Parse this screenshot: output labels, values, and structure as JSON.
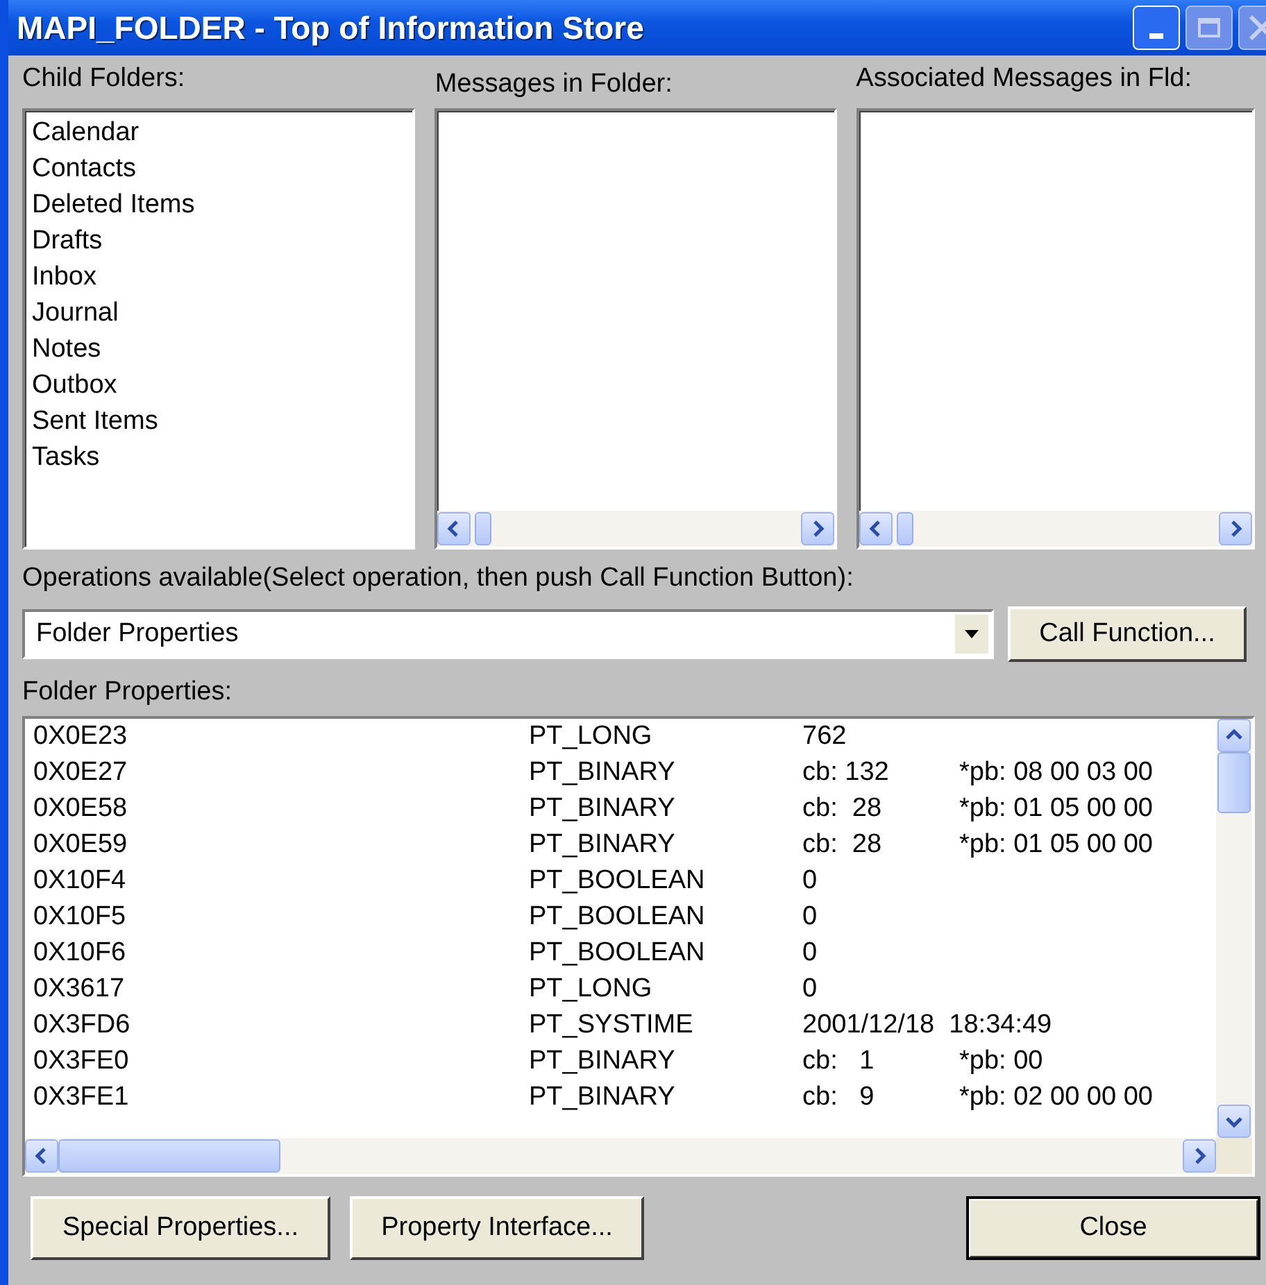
{
  "window": {
    "title": "MAPI_FOLDER - Top of Information Store"
  },
  "child_folders": {
    "label": "Child Folders:",
    "items": [
      "Calendar",
      "Contacts",
      "Deleted Items",
      "Drafts",
      "Inbox",
      "Journal",
      "Notes",
      "Outbox",
      "Sent Items",
      "Tasks"
    ]
  },
  "messages": {
    "label": "Messages in Folder:"
  },
  "associated_messages": {
    "label": "Associated Messages in Fld:"
  },
  "operations": {
    "label": "Operations available(Select operation, then push Call Function Button):",
    "value": "Folder Properties",
    "button": "Call Function..."
  },
  "properties": {
    "label": "Folder Properties:",
    "rows": [
      {
        "tag": "0X0E23",
        "type": "PT_LONG",
        "value": "762",
        "data": ""
      },
      {
        "tag": "0X0E27",
        "type": "PT_BINARY",
        "value": "cb: 132",
        "data": "*pb: 08 00 03 00"
      },
      {
        "tag": "0X0E58",
        "type": "PT_BINARY",
        "value": "cb:  28",
        "data": "*pb: 01 05 00 00"
      },
      {
        "tag": "0X0E59",
        "type": "PT_BINARY",
        "value": "cb:  28",
        "data": "*pb: 01 05 00 00"
      },
      {
        "tag": "0X10F4",
        "type": "PT_BOOLEAN",
        "value": "0",
        "data": ""
      },
      {
        "tag": "0X10F5",
        "type": "PT_BOOLEAN",
        "value": "0",
        "data": ""
      },
      {
        "tag": "0X10F6",
        "type": "PT_BOOLEAN",
        "value": "0",
        "data": ""
      },
      {
        "tag": "0X3617",
        "type": "PT_LONG",
        "value": "0",
        "data": ""
      },
      {
        "tag": "0X3FD6",
        "type": "PT_SYSTIME",
        "value": "2001/12/18  18:34:49",
        "data": ""
      },
      {
        "tag": "0X3FE0",
        "type": "PT_BINARY",
        "value": "cb:   1",
        "data": "*pb: 00"
      },
      {
        "tag": "0X3FE1",
        "type": "PT_BINARY",
        "value": "cb:   9",
        "data": "*pb: 02 00 00 00"
      }
    ]
  },
  "buttons": [
    {
      "label": "Special Properties...",
      "default": false
    },
    {
      "label": "Property Interface...",
      "default": false
    },
    {
      "label": "Close",
      "default": true
    }
  ]
}
